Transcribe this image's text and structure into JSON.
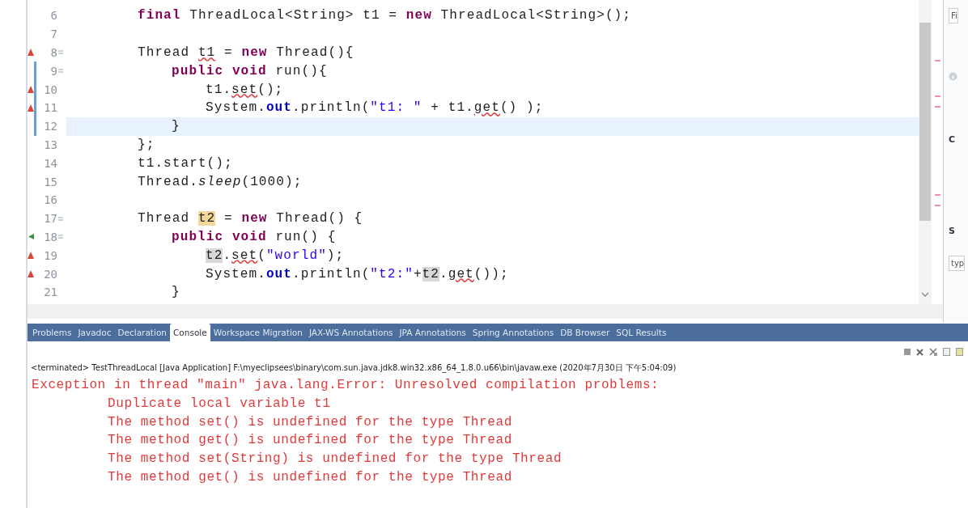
{
  "editor": {
    "lines": [
      {
        "number": "6",
        "error": false,
        "override": false,
        "fold": false,
        "changed": false,
        "current": false,
        "segments": [
          {
            "text": "final",
            "kind": "kw"
          },
          {
            "text": " ThreadLocal<String> t1 = ",
            "kind": "text"
          },
          {
            "text": "new",
            "kind": "kw"
          },
          {
            "text": " ThreadLocal<String>();",
            "kind": "text"
          }
        ]
      },
      {
        "number": "7",
        "error": false,
        "override": false,
        "fold": false,
        "changed": false,
        "current": false
      },
      {
        "number": "8",
        "error": true,
        "override": false,
        "fold": true,
        "changed": false,
        "current": false,
        "segments": [
          {
            "text": "Thread ",
            "kind": "text"
          },
          {
            "text": "t1",
            "kind": "err"
          },
          {
            "text": " = ",
            "kind": "text"
          },
          {
            "text": "new",
            "kind": "kw"
          },
          {
            "text": " Thread(){",
            "kind": "text"
          }
        ],
        "children": [
          {
            "number": "9",
            "error": false,
            "override": false,
            "fold": true,
            "changed": true,
            "current": false,
            "segments": [
              {
                "text": "public void",
                "kind": "kw"
              },
              {
                "text": " run(){",
                "kind": "text"
              }
            ],
            "children": [
              {
                "number": "10",
                "error": true,
                "override": false,
                "fold": false,
                "changed": true,
                "current": false,
                "segments": [
                  {
                    "text": "t1.",
                    "kind": "text"
                  },
                  {
                    "text": "set",
                    "kind": "err"
                  },
                  {
                    "text": "();",
                    "kind": "text"
                  }
                ]
              },
              {
                "number": "11",
                "error": true,
                "override": false,
                "fold": false,
                "changed": true,
                "current": false,
                "segments": [
                  {
                    "text": "System.",
                    "kind": "text"
                  },
                  {
                    "text": "out",
                    "kind": "field"
                  },
                  {
                    "text": ".println(",
                    "kind": "text"
                  },
                  {
                    "text": "\"t1: \"",
                    "kind": "str"
                  },
                  {
                    "text": " + t1.",
                    "kind": "text"
                  },
                  {
                    "text": "get",
                    "kind": "err"
                  },
                  {
                    "text": "() );",
                    "kind": "text"
                  }
                ]
              }
            ]
          },
          {
            "number": "12",
            "error": false,
            "override": false,
            "fold": false,
            "changed": true,
            "current": true,
            "segments": [
              {
                "text": "}",
                "kind": "text"
              }
            ]
          }
        ]
      },
      {
        "number": "13",
        "error": false,
        "override": false,
        "fold": false,
        "changed": false,
        "current": false,
        "segments": [
          {
            "text": "};",
            "kind": "text"
          }
        ]
      },
      {
        "number": "14",
        "error": false,
        "override": false,
        "fold": false,
        "changed": false,
        "current": false,
        "segments": [
          {
            "text": "t1.start();",
            "kind": "text"
          }
        ]
      },
      {
        "number": "15",
        "error": false,
        "override": false,
        "fold": false,
        "changed": false,
        "current": false,
        "segments": [
          {
            "text": "Thread.",
            "kind": "text"
          },
          {
            "text": "sleep",
            "kind": "static"
          },
          {
            "text": "(1000);",
            "kind": "text"
          }
        ]
      },
      {
        "number": "16",
        "error": false,
        "override": false,
        "fold": false,
        "changed": false,
        "current": false
      },
      {
        "number": "17",
        "error": false,
        "override": false,
        "fold": true,
        "changed": false,
        "current": false,
        "segments": [
          {
            "text": "Thread ",
            "kind": "text"
          },
          {
            "text": "t2",
            "kind": "write"
          },
          {
            "text": " = ",
            "kind": "text"
          },
          {
            "text": "new",
            "kind": "kw"
          },
          {
            "text": " Thread() {",
            "kind": "text"
          }
        ],
        "children": [
          {
            "number": "18",
            "error": false,
            "override": true,
            "fold": true,
            "changed": false,
            "current": false,
            "segments": [
              {
                "text": "public void",
                "kind": "kw"
              },
              {
                "text": " run() {",
                "kind": "text"
              }
            ],
            "children": [
              {
                "number": "19",
                "error": true,
                "override": false,
                "fold": false,
                "changed": false,
                "current": false,
                "segments": [
                  {
                    "text": "t2",
                    "kind": "read"
                  },
                  {
                    "text": ".",
                    "kind": "text"
                  },
                  {
                    "text": "set",
                    "kind": "err"
                  },
                  {
                    "text": "(",
                    "kind": "text"
                  },
                  {
                    "text": "\"world\"",
                    "kind": "str"
                  },
                  {
                    "text": ");",
                    "kind": "text"
                  }
                ]
              },
              {
                "number": "20",
                "error": true,
                "override": false,
                "fold": false,
                "changed": false,
                "current": false,
                "segments": [
                  {
                    "text": "System.",
                    "kind": "text"
                  },
                  {
                    "text": "out",
                    "kind": "field"
                  },
                  {
                    "text": ".println(",
                    "kind": "text"
                  },
                  {
                    "text": "\"t2:\"",
                    "kind": "str"
                  },
                  {
                    "text": "+",
                    "kind": "text"
                  },
                  {
                    "text": "t2",
                    "kind": "read"
                  },
                  {
                    "text": ".",
                    "kind": "text"
                  },
                  {
                    "text": "get",
                    "kind": "err"
                  },
                  {
                    "text": "());",
                    "kind": "text"
                  }
                ]
              }
            ]
          },
          {
            "number": "21",
            "error": false,
            "override": false,
            "fold": false,
            "changed": false,
            "current": false,
            "segments": [
              {
                "text": "}",
                "kind": "text"
              }
            ]
          }
        ]
      }
    ]
  },
  "side_panel": {
    "texts": [
      "Fi",
      "C",
      "S",
      "typ"
    ]
  },
  "views": {
    "tabs": [
      {
        "label": "Problems",
        "selected": false
      },
      {
        "label": "Javadoc",
        "selected": false
      },
      {
        "label": "Declaration",
        "selected": false
      },
      {
        "label": "Console",
        "selected": true
      },
      {
        "label": "Workspace Migration",
        "selected": false
      },
      {
        "label": "JAX-WS Annotations",
        "selected": false
      },
      {
        "label": "JPA Annotations",
        "selected": false
      },
      {
        "label": "Spring Annotations",
        "selected": false
      },
      {
        "label": "DB Browser",
        "selected": false
      },
      {
        "label": "SQL Results",
        "selected": false
      }
    ]
  },
  "console": {
    "header": "<terminated> TestThreadLocal [Java Application] F:\\myeclipsees\\binary\\com.sun.java.jdk8.win32.x86_64_1.8.0.u66\\bin\\javaw.exe (2020年7月30日 下午5:04:09)",
    "lines": [
      {
        "text": "Exception in thread \"main\" java.lang.Error: Unresolved compilation problems:",
        "indented": false
      },
      {
        "text": "Duplicate local variable t1",
        "indented": true
      },
      {
        "text": "The method set() is undefined for the type Thread",
        "indented": true
      },
      {
        "text": "The method get() is undefined for the type Thread",
        "indented": true
      },
      {
        "text": "The method set(String) is undefined for the type Thread",
        "indented": true
      },
      {
        "text": "The method get() is undefined for the type Thread",
        "indented": true
      }
    ]
  }
}
